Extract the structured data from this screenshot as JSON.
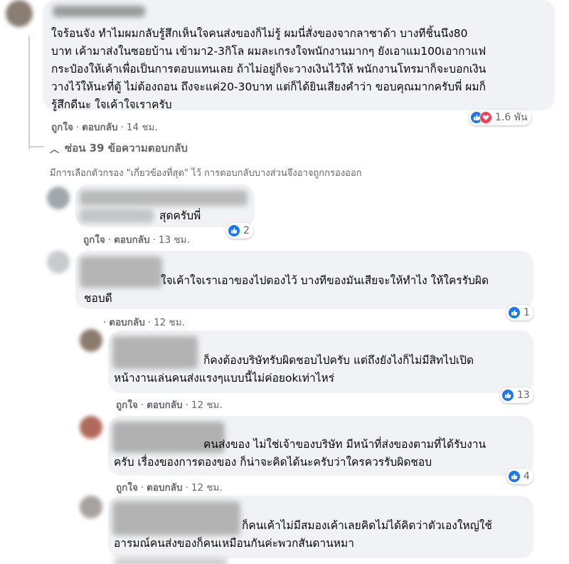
{
  "top_comment": {
    "text_lines": [
      "ใจร้อนจัง ทำไมผมกลับรู้สึกเห็นใจคนส่งของก็ไม่รู้ ผมนี่สั่งของจากลาซาด้า บางทีชิ้นนึง80",
      "บาท เค้ามาส่งในซอยบ้าน เข้ามา2-3กิโล ผมละเกรงใจพนักงานมากๆ ยังเอาแม100เอากาแฟ",
      "กระป๋องให้เค้าเพื่อเป็นการตอบแทนเลย ถ้าไม่อยู่ก็จะวางเงินไว้ให้ พนักงานโทรมาก็จะบอกเงิน",
      "วางไว้ให้นะที่ตู้ ไม่ต้องถอน ถึงจะแค่20-30บาท แต่ก็ได้ยินเสียงคำว่า ขอบคุณมากครับพี่ ผมก็",
      "รู้สึกดีนะ ใจเค้าใจเราครับ"
    ],
    "like": "ถูกใจ",
    "reply": "ตอบกลับ",
    "time": "14 ชม.",
    "reaction_count": "1.6 พัน"
  },
  "hide_replies": "ซ่อน 39 ข้อความตอบกลับ",
  "filter_note": "มีการเลือกตัวกรอง \"เกี่ยวข้องที่สุด\" ไว้ การตอบกลับบางส่วนจึงอาจถูกกรองออก",
  "replies": [
    {
      "text_lines": [
        "สุดครับพี่"
      ],
      "like": "ถูกใจ",
      "reply": "ตอบกลับ",
      "time": "13 ชม.",
      "reaction_count": "2"
    },
    {
      "text_lines": [
        "ใจเค้าใจเราเอาของไปตองไว้ บางทีของมันเสียจะให้ทำไง ให้ใครรับผิด",
        "ชอบดี"
      ],
      "like": "",
      "reply": "ตอบกลับ",
      "time": "12 ชม.",
      "reaction_count": "1"
    },
    {
      "text_lines": [
        "ก็คงต้องบริษัทรับผิดชอบไปครับ แต่ถึงยังไงก็ไม่มีสิทไปเปิด",
        "หน้างานเล่นคนส่งแรงๆแบบนี้ไม่ค่อยokเท่าไหร่"
      ],
      "like": "ถูกใจ",
      "reply": "ตอบกลับ",
      "time": "12 ชม.",
      "reaction_count": "13"
    },
    {
      "text_lines": [
        "คนส่งของ ไม่ใช่เจ้าของบริษัท มีหน้าที่ส่งของตามที่ได้รับงาน",
        "ครับ เรื่องของการตองของ ก็น่าจะคิดได้นะครับว่าใครควรรับผิดชอบ"
      ],
      "like": "ถูกใจ",
      "reply": "ตอบกลับ",
      "time": "12 ชม.",
      "reaction_count": "4"
    },
    {
      "text_lines": [
        "ก็คนเค้าไม่มีสมองเค้าเลยคิดไม่ได้คิดว่าตัวเองใหญ่ใช้",
        "อารมณ์คนส่งของก็คนเหมือนกันค่ะพวกสันดานหมา"
      ]
    }
  ],
  "colors": {
    "like_blue": "#1877f2",
    "love_red": "#f33e58",
    "meta_gray": "#65676b",
    "bubble_bg": "#f0f2f5"
  }
}
